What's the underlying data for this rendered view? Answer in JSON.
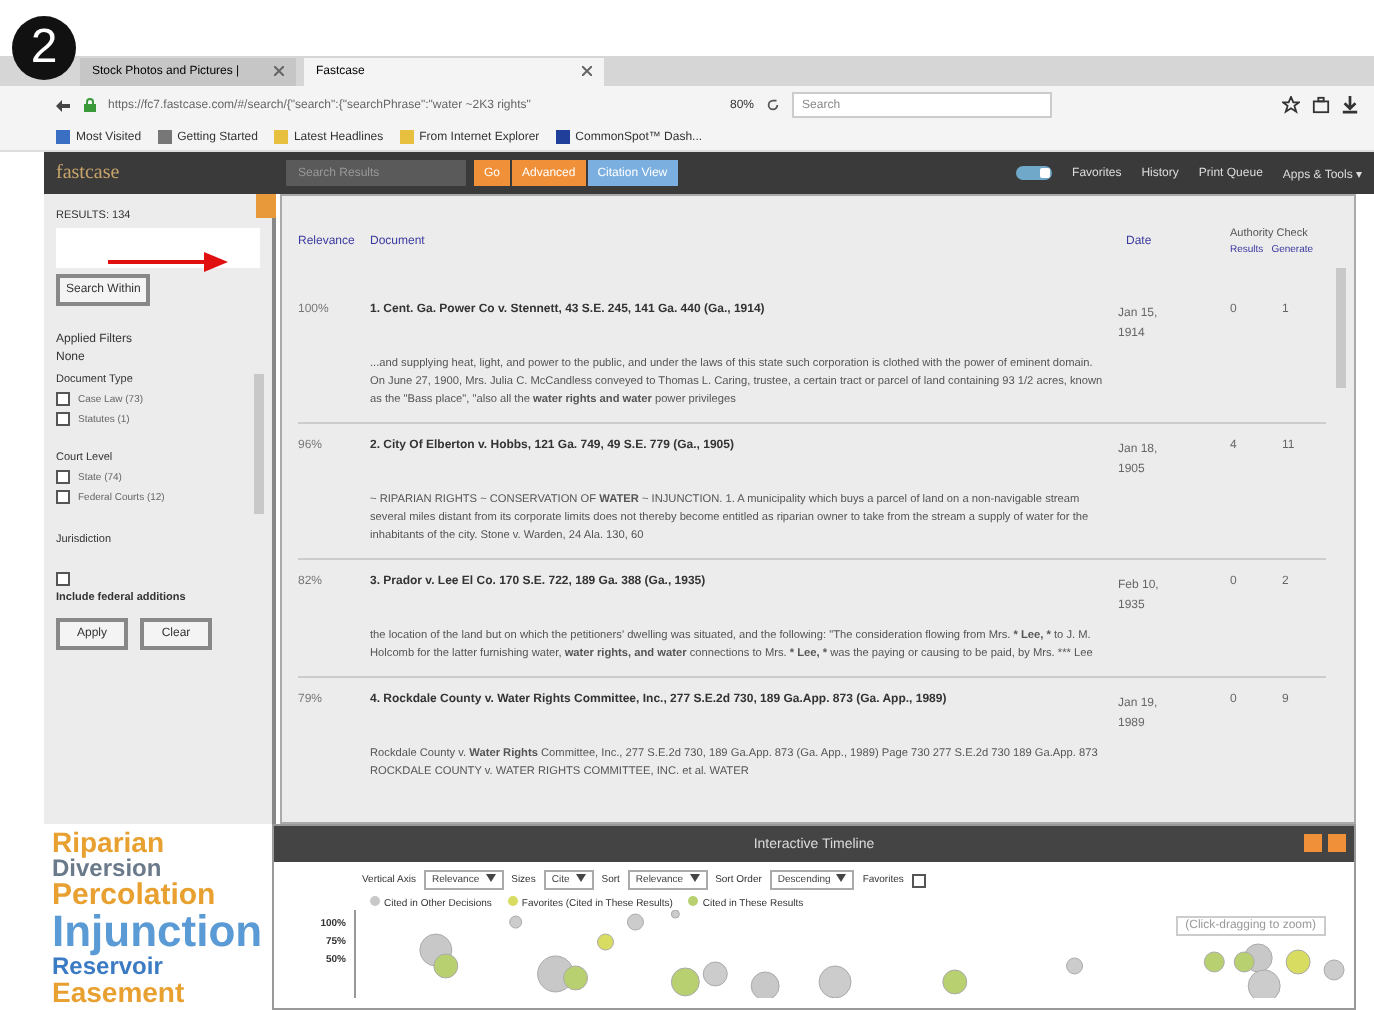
{
  "badge": "2",
  "browser": {
    "tabs": [
      {
        "label": "Stock Photos and Pictures |",
        "selected": false
      },
      {
        "label": "Fastcase",
        "selected": true
      }
    ],
    "url": "https://fc7.fastcase.com/#/search/{\"search\":{\"searchPhrase\":\"water ~2K3 rights\"",
    "zoom": "80%",
    "search_placeholder": "Search",
    "bookmarks": [
      {
        "label": "Most Visited",
        "color": "#3b6fc4"
      },
      {
        "label": "Getting Started",
        "color": "#777777"
      },
      {
        "label": "Latest Headlines",
        "color": "#e8c040"
      },
      {
        "label": "From Internet Explorer",
        "color": "#e8c040"
      },
      {
        "label": "CommonSpot™ Dash...",
        "color": "#1f3f9a"
      }
    ]
  },
  "app": {
    "logo": "fastcase",
    "search_placeholder": "Search Results",
    "buttons": [
      {
        "label": "Go",
        "kind": "orange"
      },
      {
        "label": "Advanced",
        "kind": "orange"
      },
      {
        "label": "Citation View",
        "kind": "blue"
      }
    ],
    "toggle_on": true,
    "nav": [
      "Favorites",
      "History",
      "Print Queue",
      "Apps & Tools ▾"
    ]
  },
  "sidebar": {
    "results_label": "RESULTS: 134",
    "search_button": "Search Within",
    "filters_title": "Applied Filters",
    "filters_value": "None",
    "groups": [
      {
        "title": "Document Type",
        "options": [
          {
            "label": "Case Law (73)",
            "checked": false
          },
          {
            "label": "Statutes (1)",
            "checked": false
          }
        ]
      },
      {
        "title": "Court Level",
        "options": [
          {
            "label": "State (74)",
            "checked": false
          },
          {
            "label": "Federal Courts (12)",
            "checked": false
          }
        ]
      }
    ],
    "jurisdiction": "Jurisdiction",
    "extra_option": {
      "label": "Include federal additions",
      "checked": false
    },
    "buttons": [
      "Apply",
      "Clear"
    ]
  },
  "results": {
    "columns": [
      "Relevance",
      "Document",
      "Date"
    ],
    "authority_title": "Authority Check",
    "authority_columns": [
      "Results",
      "Generate"
    ],
    "rows": [
      {
        "relevance": "100%",
        "title": "1. Cent. Ga. Power Co v. Stennett, 43 S.E. 245, 141 Ga. 440 (Ga., 1914)",
        "date": "Jan 15, 1914",
        "cited": "0",
        "citing": "1",
        "snippet": "...and supplying heat, light, and power to the public, and under the laws of this state such corporation is clothed with the power of eminent domain. On June 27, 1900, Mrs. Julia C. McCandless conveyed to Thomas L. Caring, trustee, a certain tract or parcel of land containing 93 1/2 acres, known as the \"Bass place\", \"also all the **water rights and water** power privileges"
      },
      {
        "relevance": "96%",
        "title": "2. City Of Elberton v. Hobbs, 121 Ga. 749, 49 S.E. 779 (Ga., 1905)",
        "date": "Jan 18, 1905",
        "cited": "4",
        "citing": "11",
        "snippet": "~ RIPARIAN RIGHTS ~ CONSERVATION OF **WATER** ~ INJUNCTION. 1. A municipality which buys a parcel of land on a non-navigable stream several miles distant from its corporate limits does not thereby become entitled as riparian owner to take from the stream a supply of water for the inhabitants of the city. Stone v. Warden, 24 Ala. 130, 60"
      },
      {
        "relevance": "82%",
        "title": "3. Prador v. Lee El Co. 170 S.E. 722, 189 Ga. 388 (Ga., 1935)",
        "date": "Feb 10, 1935",
        "cited": "0",
        "citing": "2",
        "snippet": "the location of the land but on which the petitioners' dwelling was situated, and the following: \"The consideration flowing from Mrs. *** Lee, *** to J. M. Holcomb for the latter furnishing water, **water rights, and water** connections to Mrs. *** Lee, *** was the paying or causing to be paid, by Mrs. *** Lee"
      },
      {
        "relevance": "79%",
        "title": "4. Rockdale County v. Water Rights Committee, Inc., 277 S.E.2d 730, 189 Ga.App. 873 (Ga. App., 1989)",
        "date": "Jan 19, 1989",
        "cited": "0",
        "citing": "9",
        "snippet": "Rockdale County v. **Water Rights** Committee, Inc., 277 S.E.2d 730, 189 Ga.App. 873 (Ga. App., 1989) Page 730 277 S.E.2d 730 189 Ga.App. 873 ROCKDALE COUNTY v. WATER RIGHTS COMMITTEE, INC. et al. WATER"
      }
    ]
  },
  "word_cloud": [
    {
      "text": "Riparian",
      "color": "#e8a030"
    },
    {
      "text": "Diversion",
      "color": "#6a7a8a"
    },
    {
      "text": "Percolation",
      "color": "#e8a030"
    },
    {
      "text": "Injunction",
      "color": "#5b9bd5"
    },
    {
      "text": "Reservoir",
      "color": "#3b7bc4"
    },
    {
      "text": "Easement",
      "color": "#e8a030"
    }
  ],
  "timeline": {
    "title": "Interactive Timeline",
    "controls": [
      {
        "label": "Vertical Axis",
        "value": "Relevance"
      },
      {
        "label": "Sizes",
        "value": "Cite"
      },
      {
        "label": "Sort",
        "value": "Relevance"
      },
      {
        "label": "Sort Order",
        "value": "Descending"
      }
    ],
    "favorites_label": "Favorites",
    "favorites_checked": false,
    "legend": [
      {
        "label": "Cited in Other Decisions",
        "color": "#c8c8c8"
      },
      {
        "label": "Favorites (Cited in These Results)",
        "color": "#d8dc60"
      },
      {
        "label": "Cited in These Results",
        "color": "#b8d070"
      }
    ],
    "hint": "(Click-dragging to zoom)",
    "y_ticks": [
      "100%",
      "75%",
      "50%"
    ]
  }
}
